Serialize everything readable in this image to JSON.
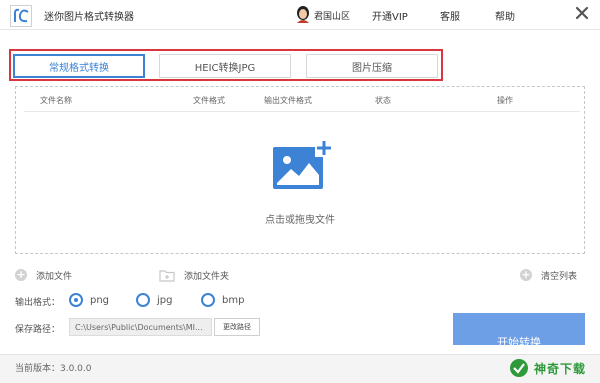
{
  "app": {
    "title": "迷你图片格式转换器"
  },
  "header": {
    "user_name": "君国山区",
    "vip_label": "开通VIP",
    "service_label": "客服",
    "help_label": "帮助"
  },
  "tabs": [
    {
      "label": "常规格式转换",
      "active": true
    },
    {
      "label": "HEIC转换JPG",
      "active": false
    },
    {
      "label": "图片压缩",
      "active": false
    }
  ],
  "table": {
    "columns": [
      "文件名称",
      "文件格式",
      "输出文件格式",
      "状态",
      "操作"
    ]
  },
  "drop_zone": {
    "hint": "点击或拖曳文件"
  },
  "actions": {
    "add_file": "添加文件",
    "add_folder": "添加文件夹",
    "clear_list": "清空列表"
  },
  "output": {
    "label": "输出格式：",
    "options": [
      "png",
      "jpg",
      "bmp"
    ],
    "selected": "png"
  },
  "save_path": {
    "label": "保存路径：",
    "value": "C:\\Users\\Public\\Documents\\MI...",
    "change_label": "更改路径"
  },
  "start": {
    "label": "开始转换"
  },
  "footer": {
    "version": "当前版本：3.0.0.0",
    "watermark": "神奇下载"
  },
  "colors": {
    "accent": "#3c83d6",
    "highlight_frame": "#d9363e",
    "start_button": "#6c9fe6",
    "watermark": "#2f9a3a"
  }
}
